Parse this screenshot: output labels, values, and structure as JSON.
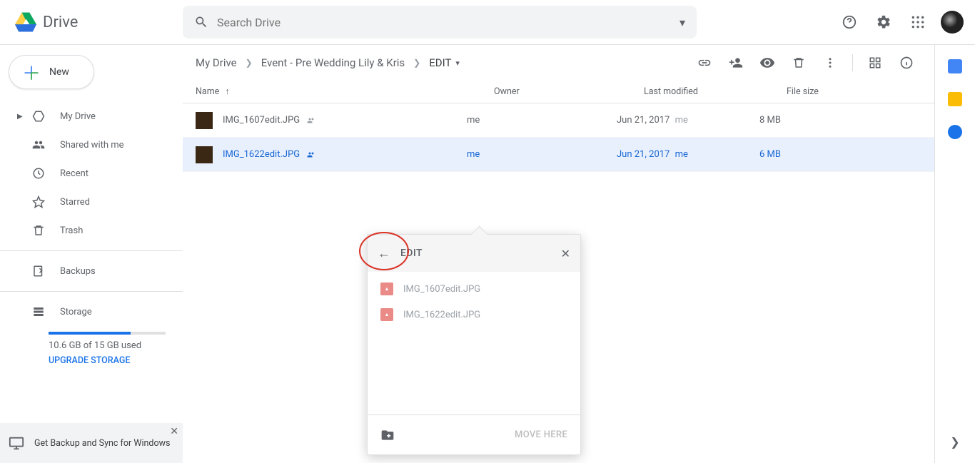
{
  "header": {
    "logo_text": "Drive",
    "search_placeholder": "Search Drive"
  },
  "sidebar": {
    "new_label": "New",
    "items": [
      {
        "label": "My Drive"
      },
      {
        "label": "Shared with me"
      },
      {
        "label": "Recent"
      },
      {
        "label": "Starred"
      },
      {
        "label": "Trash"
      }
    ],
    "backups_label": "Backups",
    "storage_label": "Storage",
    "storage_used": "10.6 GB of 15 GB used",
    "upgrade_label": "UPGRADE STORAGE",
    "promo_text": "Get Backup and Sync for Windows"
  },
  "breadcrumb": {
    "seg1": "My Drive",
    "seg2": "Event - Pre Wedding Lily & Kris",
    "current": "EDIT"
  },
  "columns": {
    "name": "Name",
    "owner": "Owner",
    "modified": "Last modified",
    "size": "File size"
  },
  "files": [
    {
      "name": "IMG_1607edit.JPG",
      "owner": "me",
      "modified": "Jun 21, 2017",
      "modified_by": "me",
      "size": "8 MB",
      "selected": false
    },
    {
      "name": "IMG_1622edit.JPG",
      "owner": "me",
      "modified": "Jun 21, 2017",
      "modified_by": "me",
      "size": "6 MB",
      "selected": true
    }
  ],
  "popup": {
    "title": "EDIT",
    "items": [
      {
        "name": "IMG_1607edit.JPG"
      },
      {
        "name": "IMG_1622edit.JPG"
      }
    ],
    "move_label": "MOVE HERE"
  }
}
